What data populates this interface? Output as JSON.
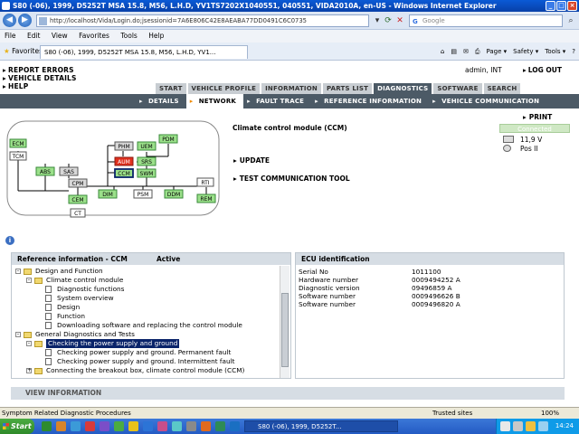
{
  "browser": {
    "title": "S80 (-06), 1999, D5252T MSA 15.8, M56, L.H.D, YV1TS7202X1040551, 040551, VIDA2010A, en-US - Windows Internet Explorer",
    "url": "http://localhost/Vida/Login.do;jsessionid=7A6E806C42E8AEABA77DD0491C6C0735",
    "search_placeholder": "Google",
    "menu": [
      "File",
      "Edit",
      "View",
      "Favorites",
      "Tools",
      "Help"
    ],
    "favorites_label": "Favorites",
    "tab_title": "S80 (-06), 1999, D5252T MSA 15.8, M56, L.H.D, YV1...",
    "commands": [
      "Page ▾",
      "Safety ▾",
      "Tools ▾",
      "?"
    ],
    "status_text": "Symptom Related Diagnostic Procedures",
    "trusted": "Trusted sites",
    "zoom": "100%"
  },
  "app": {
    "left_links": [
      "REPORT ERRORS",
      "VEHICLE DETAILS",
      "HELP"
    ],
    "user": "admin, INT",
    "logout": "LOG OUT",
    "main_tabs": [
      "START",
      "VEHICLE PROFILE",
      "INFORMATION",
      "PARTS LIST",
      "DIAGNOSTICS",
      "SOFTWARE",
      "SEARCH"
    ],
    "active_main_tab": "DIAGNOSTICS",
    "sub_tabs": [
      "DETAILS",
      "NETWORK",
      "FAULT TRACE",
      "REFERENCE INFORMATION",
      "VEHICLE COMMUNICATION"
    ],
    "active_sub_tab": "NETWORK",
    "print": "PRINT",
    "module_title": "Climate control module (CCM)",
    "actions": [
      "UPDATE",
      "TEST COMMUNICATION TOOL"
    ],
    "connected": "Connected",
    "voltage": "11,9 V",
    "position": "Pos II",
    "network_nodes": [
      "ECM",
      "TCM",
      "ABS",
      "SAS",
      "CPM",
      "CEM",
      "CT",
      "PHM",
      "UEM",
      "PDM",
      "AUM",
      "SRS",
      "CCM",
      "SWM",
      "DIM",
      "PSM",
      "DDM",
      "RTI",
      "REM"
    ],
    "ref_panel": {
      "title": "Reference information - CCM",
      "status": "Active",
      "tree": [
        {
          "level": 0,
          "type": "folder",
          "toggle": "-",
          "label": "Design and Function"
        },
        {
          "level": 1,
          "type": "folder",
          "toggle": "-",
          "label": "Climate control module"
        },
        {
          "level": 2,
          "type": "doc",
          "label": "Diagnostic functions"
        },
        {
          "level": 2,
          "type": "doc",
          "label": "System overview"
        },
        {
          "level": 2,
          "type": "doc",
          "label": "Design"
        },
        {
          "level": 2,
          "type": "doc",
          "label": "Function"
        },
        {
          "level": 2,
          "type": "doc",
          "label": "Downloading software and replacing the control module"
        },
        {
          "level": 0,
          "type": "folder",
          "toggle": "-",
          "label": "General Diagnostics and Tests"
        },
        {
          "level": 1,
          "type": "folder",
          "toggle": "-",
          "label": "Checking the power supply and ground",
          "selected": true
        },
        {
          "level": 2,
          "type": "doc",
          "label": "Checking power supply and ground. Permanent fault"
        },
        {
          "level": 2,
          "type": "doc",
          "label": "Checking power supply and ground. Intermittent fault"
        },
        {
          "level": 1,
          "type": "folder",
          "toggle": "+",
          "label": "Connecting the breakout box, climate control module (CCM)"
        }
      ]
    },
    "ecu_panel": {
      "title": "ECU identification",
      "rows": [
        {
          "label": "Serial No",
          "value": "1011100"
        },
        {
          "label": "Hardware number",
          "value": "0009494252  A"
        },
        {
          "label": "Diagnostic version",
          "value": "09496859  A"
        },
        {
          "label": "Software number",
          "value": "0009496626  B"
        },
        {
          "label": "Software number",
          "value": "0009496820  A"
        }
      ]
    },
    "view_info": "VIEW INFORMATION"
  },
  "taskbar": {
    "start": "Start",
    "task": "S80 (-06), 1999, D5252T...",
    "clock": "14:24"
  },
  "colors": {
    "header_dark": "#4c5a66",
    "node_green": "#9be08a",
    "node_red": "#e0301e",
    "node_grey": "#d8d8d8",
    "selection": "#0a246a"
  }
}
